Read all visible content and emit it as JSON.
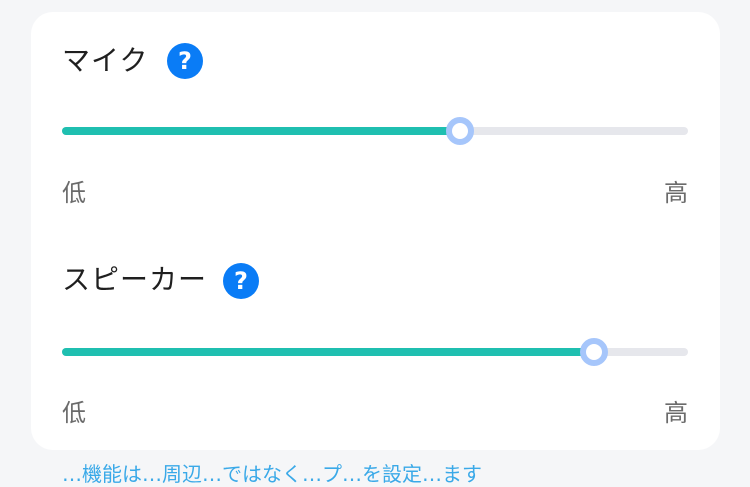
{
  "colors": {
    "fill": "#1fbfb0",
    "track": "#e6e7ec",
    "thumb_border": "#a6c6fb",
    "help_icon": "#0a7cf6"
  },
  "mic": {
    "title": "マイク",
    "help_icon": "?",
    "level": 0.636,
    "low_label": "低",
    "high_label": "高"
  },
  "speaker": {
    "title": "スピーカー",
    "help_icon": "?",
    "level": 0.85,
    "low_label": "低",
    "high_label": "高"
  },
  "footer_hint": "…機能は…周辺…ではなく…プ…を設定…ます"
}
